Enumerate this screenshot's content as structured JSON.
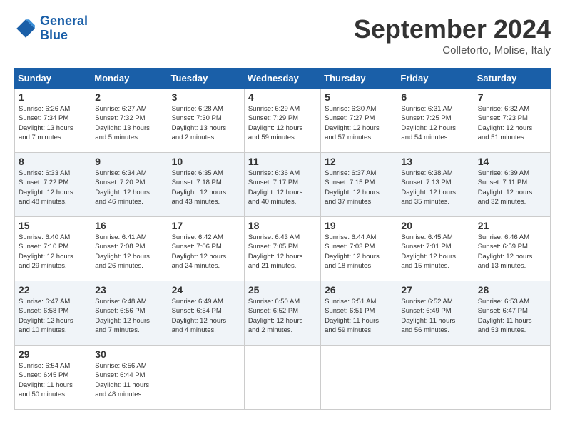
{
  "header": {
    "logo_line1": "General",
    "logo_line2": "Blue",
    "month": "September 2024",
    "location": "Colletorto, Molise, Italy"
  },
  "days_of_week": [
    "Sunday",
    "Monday",
    "Tuesday",
    "Wednesday",
    "Thursday",
    "Friday",
    "Saturday"
  ],
  "weeks": [
    [
      {
        "day": "1",
        "info": "Sunrise: 6:26 AM\nSunset: 7:34 PM\nDaylight: 13 hours\nand 7 minutes."
      },
      {
        "day": "2",
        "info": "Sunrise: 6:27 AM\nSunset: 7:32 PM\nDaylight: 13 hours\nand 5 minutes."
      },
      {
        "day": "3",
        "info": "Sunrise: 6:28 AM\nSunset: 7:30 PM\nDaylight: 13 hours\nand 2 minutes."
      },
      {
        "day": "4",
        "info": "Sunrise: 6:29 AM\nSunset: 7:29 PM\nDaylight: 12 hours\nand 59 minutes."
      },
      {
        "day": "5",
        "info": "Sunrise: 6:30 AM\nSunset: 7:27 PM\nDaylight: 12 hours\nand 57 minutes."
      },
      {
        "day": "6",
        "info": "Sunrise: 6:31 AM\nSunset: 7:25 PM\nDaylight: 12 hours\nand 54 minutes."
      },
      {
        "day": "7",
        "info": "Sunrise: 6:32 AM\nSunset: 7:23 PM\nDaylight: 12 hours\nand 51 minutes."
      }
    ],
    [
      {
        "day": "8",
        "info": "Sunrise: 6:33 AM\nSunset: 7:22 PM\nDaylight: 12 hours\nand 48 minutes."
      },
      {
        "day": "9",
        "info": "Sunrise: 6:34 AM\nSunset: 7:20 PM\nDaylight: 12 hours\nand 46 minutes."
      },
      {
        "day": "10",
        "info": "Sunrise: 6:35 AM\nSunset: 7:18 PM\nDaylight: 12 hours\nand 43 minutes."
      },
      {
        "day": "11",
        "info": "Sunrise: 6:36 AM\nSunset: 7:17 PM\nDaylight: 12 hours\nand 40 minutes."
      },
      {
        "day": "12",
        "info": "Sunrise: 6:37 AM\nSunset: 7:15 PM\nDaylight: 12 hours\nand 37 minutes."
      },
      {
        "day": "13",
        "info": "Sunrise: 6:38 AM\nSunset: 7:13 PM\nDaylight: 12 hours\nand 35 minutes."
      },
      {
        "day": "14",
        "info": "Sunrise: 6:39 AM\nSunset: 7:11 PM\nDaylight: 12 hours\nand 32 minutes."
      }
    ],
    [
      {
        "day": "15",
        "info": "Sunrise: 6:40 AM\nSunset: 7:10 PM\nDaylight: 12 hours\nand 29 minutes."
      },
      {
        "day": "16",
        "info": "Sunrise: 6:41 AM\nSunset: 7:08 PM\nDaylight: 12 hours\nand 26 minutes."
      },
      {
        "day": "17",
        "info": "Sunrise: 6:42 AM\nSunset: 7:06 PM\nDaylight: 12 hours\nand 24 minutes."
      },
      {
        "day": "18",
        "info": "Sunrise: 6:43 AM\nSunset: 7:05 PM\nDaylight: 12 hours\nand 21 minutes."
      },
      {
        "day": "19",
        "info": "Sunrise: 6:44 AM\nSunset: 7:03 PM\nDaylight: 12 hours\nand 18 minutes."
      },
      {
        "day": "20",
        "info": "Sunrise: 6:45 AM\nSunset: 7:01 PM\nDaylight: 12 hours\nand 15 minutes."
      },
      {
        "day": "21",
        "info": "Sunrise: 6:46 AM\nSunset: 6:59 PM\nDaylight: 12 hours\nand 13 minutes."
      }
    ],
    [
      {
        "day": "22",
        "info": "Sunrise: 6:47 AM\nSunset: 6:58 PM\nDaylight: 12 hours\nand 10 minutes."
      },
      {
        "day": "23",
        "info": "Sunrise: 6:48 AM\nSunset: 6:56 PM\nDaylight: 12 hours\nand 7 minutes."
      },
      {
        "day": "24",
        "info": "Sunrise: 6:49 AM\nSunset: 6:54 PM\nDaylight: 12 hours\nand 4 minutes."
      },
      {
        "day": "25",
        "info": "Sunrise: 6:50 AM\nSunset: 6:52 PM\nDaylight: 12 hours\nand 2 minutes."
      },
      {
        "day": "26",
        "info": "Sunrise: 6:51 AM\nSunset: 6:51 PM\nDaylight: 11 hours\nand 59 minutes."
      },
      {
        "day": "27",
        "info": "Sunrise: 6:52 AM\nSunset: 6:49 PM\nDaylight: 11 hours\nand 56 minutes."
      },
      {
        "day": "28",
        "info": "Sunrise: 6:53 AM\nSunset: 6:47 PM\nDaylight: 11 hours\nand 53 minutes."
      }
    ],
    [
      {
        "day": "29",
        "info": "Sunrise: 6:54 AM\nSunset: 6:45 PM\nDaylight: 11 hours\nand 50 minutes."
      },
      {
        "day": "30",
        "info": "Sunrise: 6:56 AM\nSunset: 6:44 PM\nDaylight: 11 hours\nand 48 minutes."
      },
      {
        "day": "",
        "info": ""
      },
      {
        "day": "",
        "info": ""
      },
      {
        "day": "",
        "info": ""
      },
      {
        "day": "",
        "info": ""
      },
      {
        "day": "",
        "info": ""
      }
    ]
  ]
}
